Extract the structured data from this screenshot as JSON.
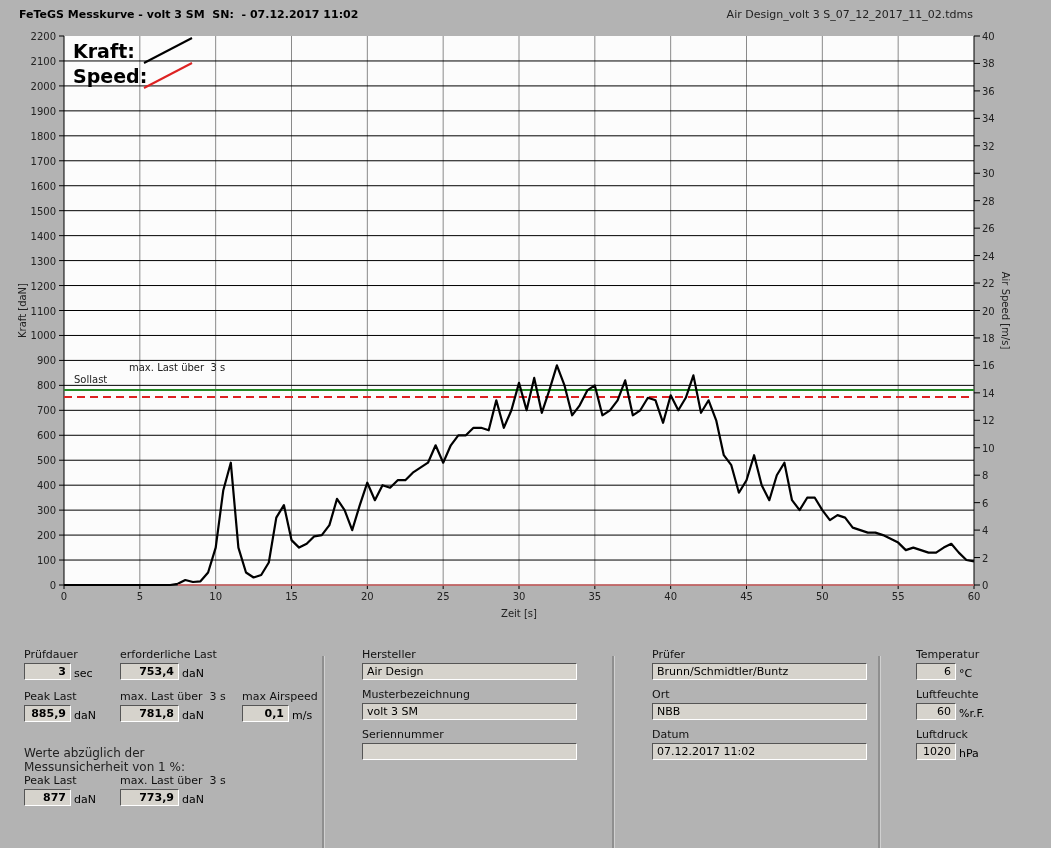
{
  "header": {
    "title": "FeTeGS Messkurve - volt 3 SM  SN:  - 07.12.2017 11:02",
    "file": "Air Design_volt 3 S_07_12_2017_11_02.tdms"
  },
  "chart": {
    "legend": [
      {
        "label": "Kraft:",
        "color": "#000000"
      },
      {
        "label": "Speed:",
        "color": "#dd2222"
      }
    ],
    "chart_data": {
      "type": "line",
      "xlabel": "Zeit [s]",
      "ylabel": "Kraft [daN]",
      "y2label": "Air Speed [m/s]",
      "x": [
        0,
        0.5,
        1,
        1.5,
        2,
        2.5,
        3,
        3.5,
        4,
        4.5,
        5,
        5.5,
        6,
        6.5,
        7,
        7.5,
        8,
        8.5,
        9,
        9.5,
        10,
        10.5,
        11,
        11.5,
        12,
        12.5,
        13,
        13.5,
        14,
        14.5,
        15,
        15.5,
        16,
        16.5,
        17,
        17.5,
        18,
        18.5,
        19,
        19.5,
        20,
        20.5,
        21,
        21.5,
        22,
        22.5,
        23,
        23.5,
        24,
        24.5,
        25,
        25.5,
        26,
        26.5,
        27,
        27.5,
        28,
        28.5,
        29,
        29.5,
        30,
        30.5,
        31,
        31.5,
        32,
        32.5,
        33,
        33.5,
        34,
        34.5,
        35,
        35.5,
        36,
        36.5,
        37,
        37.5,
        38,
        38.5,
        39,
        39.5,
        40,
        40.5,
        41,
        41.5,
        42,
        42.5,
        43,
        43.5,
        44,
        44.5,
        45,
        45.5,
        46,
        46.5,
        47,
        47.5,
        48,
        48.5,
        49,
        49.5,
        50,
        50.5,
        51,
        51.5,
        52,
        52.5,
        53,
        53.5,
        54,
        54.5,
        55,
        55.5,
        56,
        56.5,
        57,
        57.5,
        58,
        58.5,
        59,
        59.5,
        60
      ],
      "series": [
        {
          "color": "#000000",
          "values": [
            0,
            0,
            0,
            0,
            0,
            0,
            0,
            0,
            0,
            0,
            0,
            0,
            0,
            0,
            0,
            5,
            20,
            12,
            15,
            50,
            150,
            380,
            490,
            150,
            50,
            30,
            40,
            90,
            270,
            320,
            180,
            150,
            165,
            195,
            200,
            240,
            345,
            300,
            220,
            320,
            410,
            340,
            400,
            390,
            420,
            420,
            450,
            470,
            490,
            560,
            490,
            560,
            600,
            600,
            630,
            630,
            620,
            740,
            630,
            700,
            810,
            700,
            830,
            690,
            780,
            880,
            800,
            680,
            720,
            780,
            800,
            680,
            700,
            740,
            820,
            680,
            700,
            750,
            740,
            650,
            760,
            700,
            750,
            840,
            690,
            740,
            660,
            520,
            480,
            370,
            420,
            520,
            400,
            340,
            440,
            490,
            340,
            300,
            350,
            350,
            300,
            260,
            280,
            270,
            230,
            220,
            210,
            210,
            200,
            185,
            170,
            140,
            150,
            140,
            130,
            130,
            150,
            165,
            130,
            100,
            95
          ]
        },
        {
          "color": "#e07070",
          "axis": "y2",
          "values": [
            null,
            null,
            null,
            null,
            null,
            null,
            null,
            null,
            null,
            null,
            null,
            null,
            null,
            null,
            null,
            0,
            0,
            0,
            0,
            0,
            0,
            0,
            0,
            0,
            0,
            0,
            0,
            0,
            0,
            0,
            0,
            0,
            0,
            0,
            0,
            0,
            0,
            0,
            0,
            0,
            0,
            0,
            0,
            0,
            0,
            0,
            0,
            0,
            0,
            0,
            0,
            0,
            0,
            0,
            0,
            0,
            0,
            0,
            0,
            0,
            0,
            0,
            0,
            0,
            0,
            0,
            0,
            0,
            0,
            0,
            0,
            0,
            0,
            0,
            0,
            0,
            0,
            0,
            0,
            0,
            0,
            0,
            0,
            0,
            0,
            0,
            0,
            0,
            0,
            0,
            0,
            0,
            0,
            0,
            0,
            0,
            0,
            0,
            0,
            0,
            0,
            0,
            0,
            0,
            0,
            0,
            0,
            0,
            0,
            0,
            0,
            0,
            0,
            0,
            0,
            0,
            0,
            0,
            0,
            0,
            0
          ]
        }
      ],
      "xlim": [
        0,
        60
      ],
      "ylim": [
        0,
        2200
      ],
      "y2lim": [
        0,
        40
      ],
      "xticks": [
        0,
        5,
        10,
        15,
        20,
        25,
        30,
        35,
        40,
        45,
        50,
        55,
        60
      ],
      "yticks": [
        0,
        100,
        200,
        300,
        400,
        500,
        600,
        700,
        800,
        900,
        1000,
        1100,
        1200,
        1300,
        1400,
        1500,
        1600,
        1700,
        1800,
        1900,
        2000,
        2100,
        2200
      ],
      "y2ticks": [
        0,
        2,
        4,
        6,
        8,
        10,
        12,
        14,
        16,
        18,
        20,
        22,
        24,
        26,
        28,
        30,
        32,
        34,
        36,
        38,
        40
      ],
      "grid": true,
      "ref_lines": [
        {
          "axis": "y",
          "value": 753.4,
          "label": "Sollast",
          "color": "#dd2222"
        },
        {
          "axis": "y",
          "value": 781.8,
          "label": "max. Last über  3 s",
          "color": "#228822"
        }
      ]
    }
  },
  "results": {
    "rows": [
      [
        {
          "label": "Prüfdauer",
          "value": "3",
          "unit": "sec"
        },
        {
          "label": "erforderliche Last",
          "value": "753,4",
          "unit": "daN"
        }
      ],
      [
        {
          "label": "Peak Last",
          "value": "885,9",
          "unit": "daN"
        },
        {
          "label": "max. Last über  3 s",
          "value": "781,8",
          "unit": "daN"
        },
        {
          "label": "max Airspeed",
          "value": "0,1",
          "unit": "m/s"
        }
      ]
    ],
    "note": "Werte abzüglich der\nMessunsicherheit von 1  %:",
    "corrected": [
      {
        "label": "Peak Last",
        "value": "877",
        "unit": "daN"
      },
      {
        "label": "max. Last über  3 s",
        "value": "773,9",
        "unit": "daN"
      }
    ]
  },
  "sample": [
    {
      "label": "Hersteller",
      "value": "Air Design"
    },
    {
      "label": "Musterbezeichnung",
      "value": "volt 3 SM"
    },
    {
      "label": "Seriennummer"
    }
  ],
  "test": [
    {
      "label": "Prüfer",
      "value": "Brunn/Schmidtler/Buntz"
    },
    {
      "label": "Ort",
      "value": "NBB"
    },
    {
      "label": "Datum",
      "value": "07.12.2017 11:02"
    }
  ],
  "ambient": [
    {
      "label": "Temperatur",
      "value": "6",
      "unit": "°C"
    },
    {
      "label": "Luftfeuchte",
      "value": "60",
      "unit": "%r.F."
    },
    {
      "label": "Luftdruck",
      "value": "1020",
      "unit": "hPa"
    }
  ]
}
